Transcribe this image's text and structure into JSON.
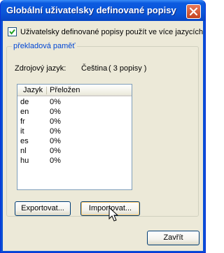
{
  "window": {
    "title": "Globální uživatelsky definované popisy"
  },
  "options": {
    "checkbox_label": "Uživatelsky definované popisy použít ve více jazycích",
    "checked": true
  },
  "group": {
    "title": "překladová paměť",
    "source_language_label": "Zdrojový jazyk:",
    "source_language_value": "Čeština",
    "source_count": "( 3 popisy )"
  },
  "table": {
    "columns": [
      "Jazyk",
      "Přeložen"
    ],
    "rows": [
      [
        "de",
        "0%"
      ],
      [
        "en",
        "0%"
      ],
      [
        "fr",
        "0%"
      ],
      [
        "it",
        "0%"
      ],
      [
        "es",
        "0%"
      ],
      [
        "nl",
        "0%"
      ],
      [
        "hu",
        "0%"
      ]
    ]
  },
  "buttons": {
    "export": "Exportovat...",
    "import": "Importovat...",
    "close": "Zavřít"
  },
  "icons": {
    "close": "close-icon",
    "checkmark": "checkmark-icon",
    "cursor": "mouse-cursor-icon"
  },
  "colors": {
    "titlebar": "#0a56d8",
    "group_title": "#0046d5",
    "close_button": "#c4421f"
  }
}
